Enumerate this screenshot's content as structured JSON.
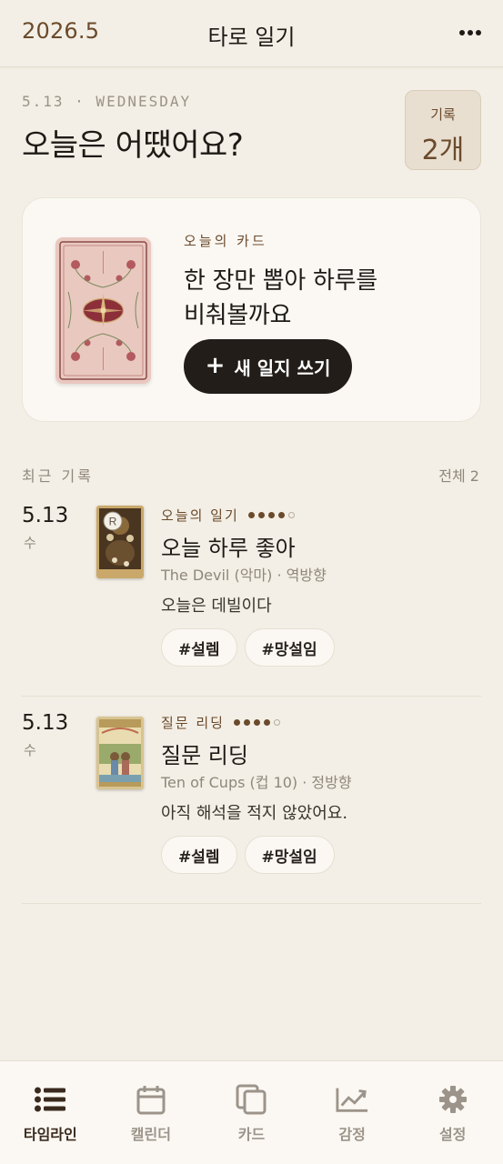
{
  "header": {
    "month": "2026.5",
    "title": "타로 일기",
    "more_icon": "more-horizontal-icon"
  },
  "today": {
    "date_line": "5.13 · WEDNESDAY",
    "question": "오늘은 어땠어요?",
    "count_label": "기록",
    "count_value": "2개"
  },
  "today_card": {
    "section_label": "오늘의 카드",
    "prompt_line1": "한 장만 뽑아 하루를",
    "prompt_line2": "비춰볼까요",
    "button_icon": "plus-icon",
    "button_plus": "+",
    "button_label": "새 일지 쓰기"
  },
  "recent": {
    "label": "최근 기록",
    "total": "전체 2"
  },
  "entries": [
    {
      "date": "5.13",
      "dow": "수",
      "reversed_badge": "R",
      "type": "오늘의 일기",
      "rating": 4,
      "rating_max": 5,
      "title": "오늘 하루 좋아",
      "card": "The Devil (악마) · 역방향",
      "note": "오늘은 데빌이다",
      "tags": [
        "#설렘",
        "#망설임"
      ]
    },
    {
      "date": "5.13",
      "dow": "수",
      "type": "질문 리딩",
      "rating": 4,
      "rating_max": 5,
      "title": "질문 리딩",
      "card": "Ten of Cups (컵 10) · 정방향",
      "note": "아직 해석을 적지 않았어요.",
      "tags": [
        "#설렘",
        "#망설임"
      ]
    }
  ],
  "tabs": [
    {
      "label": "타임라인",
      "icon": "timeline-list-icon",
      "active": true
    },
    {
      "label": "캘린더",
      "icon": "calendar-icon",
      "active": false
    },
    {
      "label": "카드",
      "icon": "cards-icon",
      "active": false
    },
    {
      "label": "감정",
      "icon": "chart-line-icon",
      "active": false
    },
    {
      "label": "설정",
      "icon": "gear-icon",
      "active": false
    }
  ],
  "colors": {
    "background": "#f3efe6",
    "accent_brown": "#6b4a2b",
    "button_dark": "#221d19",
    "card_surface": "#fbf8f3"
  }
}
